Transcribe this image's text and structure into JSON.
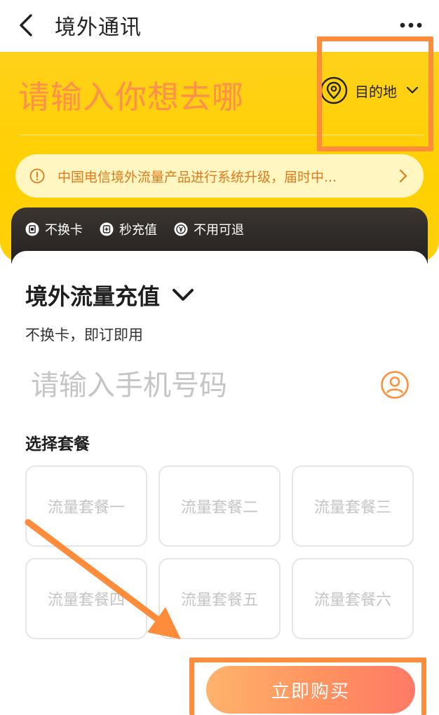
{
  "header": {
    "title": "境外通讯",
    "back_icon": "chevron-left-icon",
    "more_icon": "more-dots-icon"
  },
  "hero": {
    "destination_placeholder": "请输入你想去哪",
    "destination_button_label": "目的地",
    "notice_text": "中国电信境外流量产品进行系统升级，届时中..."
  },
  "features": [
    {
      "label": "不换卡",
      "icon": "sim-card-icon"
    },
    {
      "label": "秒充值",
      "icon": "instant-topup-icon"
    },
    {
      "label": "不用可退",
      "icon": "refund-yen-icon"
    }
  ],
  "card": {
    "title": "境外流量充值",
    "subtitle": "不换卡，即订即用",
    "phone_placeholder": "请输入手机号码",
    "phone_value": "",
    "section_label": "选择套餐",
    "packages": [
      "流量套餐一",
      "流量套餐二",
      "流量套餐三",
      "流量套餐四",
      "流量套餐五",
      "流量套餐六"
    ],
    "buy_label": "立即购买"
  },
  "colors": {
    "brand_yellow": "#ffd000",
    "accent_orange": "#ff8f4a",
    "annotation_orange": "#ff8c3a",
    "dark_strip": "#2a2725"
  }
}
